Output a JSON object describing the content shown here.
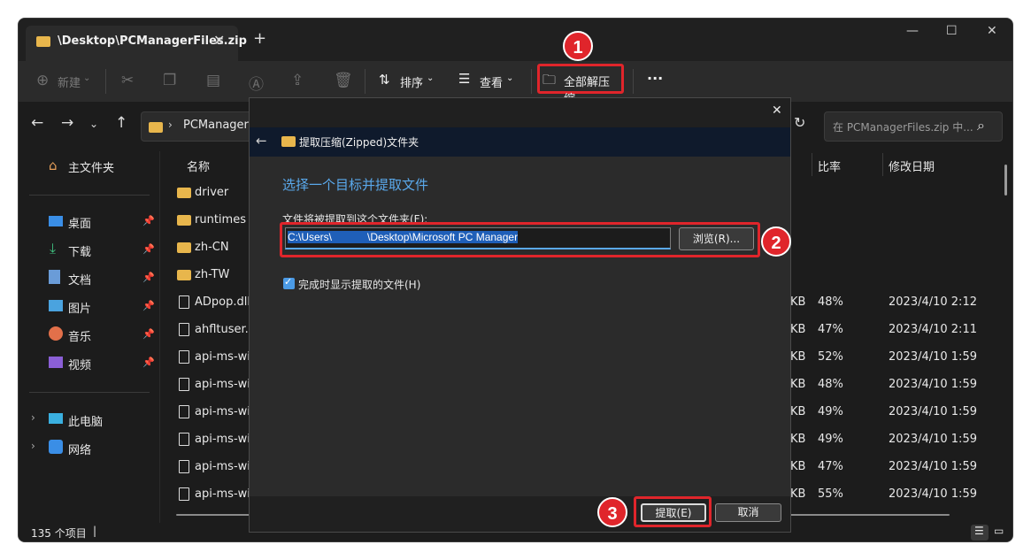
{
  "window": {
    "tab_title": "\\Desktop\\PCManagerFiles.zip",
    "tab_close": "✕",
    "new_tab": "+",
    "minimize": "—",
    "maximize": "☐",
    "close": "✕"
  },
  "toolbar": {
    "new_label": "新建",
    "sort_label": "排序",
    "view_label": "查看",
    "extract_all_label": "全部解压缩",
    "more_label": "···"
  },
  "nav": {
    "address_text": "PCManagerF",
    "search_placeholder": "在 PCManagerFiles.zip 中..."
  },
  "sidebar": {
    "home": "主文件夹",
    "items": [
      {
        "label": "桌面",
        "icon": "desktop-icon"
      },
      {
        "label": "下载",
        "icon": "download-icon"
      },
      {
        "label": "文档",
        "icon": "document-icon"
      },
      {
        "label": "图片",
        "icon": "picture-icon"
      },
      {
        "label": "音乐",
        "icon": "music-icon"
      },
      {
        "label": "视频",
        "icon": "video-icon"
      }
    ],
    "this_pc": "此电脑",
    "network": "网络"
  },
  "filelist": {
    "col_name": "名称",
    "col_ratio": "比率",
    "col_modified": "修改日期",
    "rows": [
      {
        "name": "driver",
        "type": "folder",
        "size": "",
        "ratio": "",
        "date": ""
      },
      {
        "name": "runtimes",
        "type": "folder",
        "size": "",
        "ratio": "",
        "date": ""
      },
      {
        "name": "zh-CN",
        "type": "folder",
        "size": "",
        "ratio": "",
        "date": ""
      },
      {
        "name": "zh-TW",
        "type": "folder",
        "size": "",
        "ratio": "",
        "date": ""
      },
      {
        "name": "ADpop.dll",
        "type": "file",
        "size": "KB",
        "ratio": "48%",
        "date": "2023/4/10 2:12"
      },
      {
        "name": "ahfltuser.d",
        "type": "file",
        "size": "KB",
        "ratio": "47%",
        "date": "2023/4/10 2:11"
      },
      {
        "name": "api-ms-wir",
        "type": "file",
        "size": "KB",
        "ratio": "52%",
        "date": "2023/4/10 1:59"
      },
      {
        "name": "api-ms-wir",
        "type": "file",
        "size": "KB",
        "ratio": "48%",
        "date": "2023/4/10 1:59"
      },
      {
        "name": "api-ms-wir",
        "type": "file",
        "size": "KB",
        "ratio": "49%",
        "date": "2023/4/10 1:59"
      },
      {
        "name": "api-ms-wir",
        "type": "file",
        "size": "KB",
        "ratio": "49%",
        "date": "2023/4/10 1:59"
      },
      {
        "name": "api-ms-wir",
        "type": "file",
        "size": "KB",
        "ratio": "47%",
        "date": "2023/4/10 1:59"
      },
      {
        "name": "api-ms-wir",
        "type": "file",
        "size": "KB",
        "ratio": "55%",
        "date": "2023/4/10 1:59"
      }
    ]
  },
  "status": {
    "count": "135 个项目"
  },
  "dialog": {
    "title": "提取压缩(Zipped)文件夹",
    "heading": "选择一个目标并提取文件",
    "path_label": "文件将被提取到这个文件夹(F):",
    "path_value": "C:\\Users\\            \\Desktop\\Microsoft PC Manager",
    "browse_label": "浏览(R)...",
    "checkbox_label": "完成时显示提取的文件(H)",
    "checkbox_checked": true,
    "extract_label": "提取(E)",
    "cancel_label": "取消",
    "close": "✕",
    "back": "←"
  },
  "annotations": {
    "badge1": "1",
    "badge2": "2",
    "badge3": "3",
    "color": "#e0252b"
  }
}
